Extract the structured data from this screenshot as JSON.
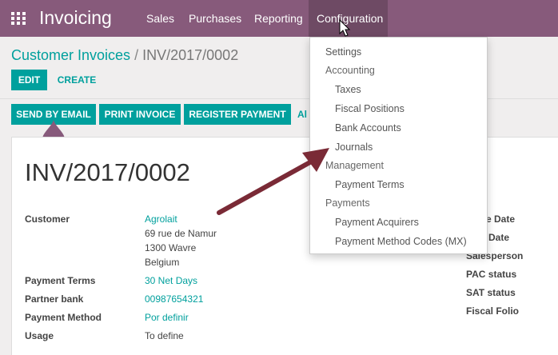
{
  "topbar": {
    "app_name": "Invoicing",
    "menu": [
      "Sales",
      "Purchases",
      "Reporting",
      "Configuration"
    ]
  },
  "breadcrumb": {
    "parent": "Customer Invoices",
    "separator": "/",
    "current": "INV/2017/0002"
  },
  "actions": {
    "edit": "EDIT",
    "create": "CREATE"
  },
  "statusbar": {
    "send_by_email": "SEND BY EMAIL",
    "print_invoice": "PRINT INVOICE",
    "register_payment": "REGISTER PAYMENT",
    "truncated": "Al"
  },
  "invoice": {
    "number": "INV/2017/0002",
    "fields": {
      "customer_label": "Customer",
      "customer_name": "Agrolait",
      "address_1": "69 rue de Namur",
      "address_2": "1300 Wavre",
      "address_3": "Belgium",
      "payment_terms_label": "Payment Terms",
      "payment_terms": "30 Net Days",
      "partner_bank_label": "Partner bank",
      "partner_bank": "00987654321",
      "payment_method_label": "Payment Method",
      "payment_method": "Por definir",
      "usage_label": "Usage",
      "usage": "To define"
    },
    "right_fields": {
      "invoice_date": "ice Date",
      "due_date": "Date",
      "salesperson": "Salesperson",
      "pac_status": "PAC status",
      "sat_status": "SAT status",
      "fiscal_folio": "Fiscal Folio"
    }
  },
  "config_menu": {
    "settings": "Settings",
    "accounting_header": "Accounting",
    "taxes": "Taxes",
    "fiscal_positions": "Fiscal Positions",
    "bank_accounts": "Bank Accounts",
    "journals": "Journals",
    "management_header": "Management",
    "payment_terms": "Payment Terms",
    "payments_header": "Payments",
    "payment_acquirers": "Payment Acquirers",
    "payment_method_codes": "Payment Method Codes (MX)"
  },
  "colors": {
    "brand": "#875a7b",
    "accent": "#00a09d",
    "arrow": "#7a2a36"
  }
}
